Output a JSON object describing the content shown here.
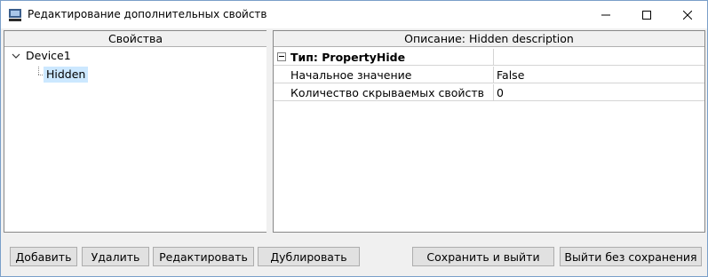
{
  "window": {
    "title": "Редактирование дополнительных свойств",
    "icon": "app-icon",
    "controls": [
      "minimize-icon",
      "maximize-icon",
      "close-icon"
    ]
  },
  "left_panel": {
    "header": "Свойства",
    "tree": {
      "root": {
        "label": "Device1",
        "expanded": true
      },
      "children": [
        {
          "label": "Hidden",
          "selected": true
        }
      ]
    }
  },
  "right_panel": {
    "header": "Описание: Hidden description",
    "grid": {
      "type_row": {
        "label": "Тип: PropertyHide",
        "value": ""
      },
      "rows": [
        {
          "name": "Начальное значение",
          "value": "False"
        },
        {
          "name": "Количество скрываемых свойств",
          "value": "0"
        }
      ]
    }
  },
  "buttons": {
    "add": "Добавить",
    "delete": "Удалить",
    "edit": "Редактировать",
    "duplicate": "Дублировать",
    "save_exit": "Сохранить и выйти",
    "exit_no_save": "Выйти без сохранения"
  },
  "colors": {
    "selection": "#cce8ff",
    "button_face": "#e1e1e1",
    "window_border": "#7a9fc9"
  }
}
